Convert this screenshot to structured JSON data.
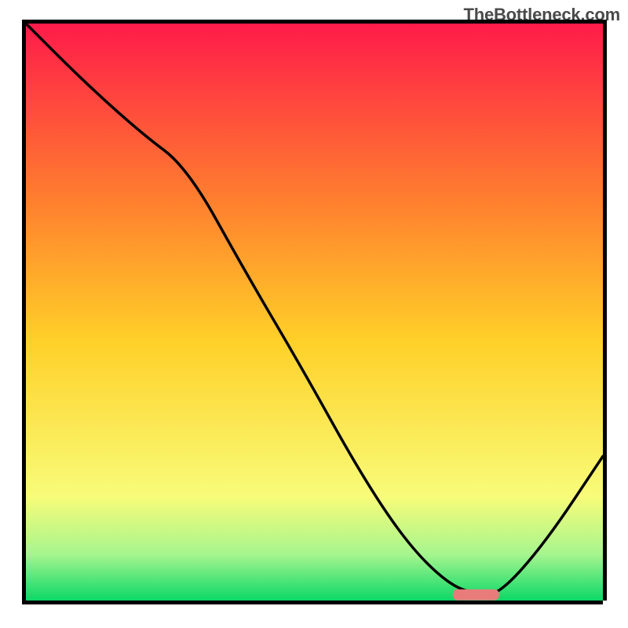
{
  "watermark": "TheBottleneck.com",
  "chart_data": {
    "type": "line",
    "title": "",
    "xlabel": "",
    "ylabel": "",
    "xlim": [
      0,
      100
    ],
    "ylim": [
      0,
      100
    ],
    "grid": false,
    "legend": "none",
    "series": [
      {
        "name": "bottleneck-curve",
        "x": [
          0,
          10,
          20,
          28,
          38,
          48,
          58,
          66,
          73,
          78,
          82,
          90,
          100
        ],
        "y": [
          100,
          90,
          81,
          75,
          57,
          40,
          22,
          10,
          3,
          1,
          1,
          10,
          25
        ]
      }
    ],
    "marker": {
      "name": "optimal-segment",
      "x_start": 74,
      "x_end": 82,
      "y": 1,
      "color": "#e97b7b"
    },
    "gradient_colors": {
      "top": "#ff1b4a",
      "upper_mid": "#ff7d2f",
      "mid": "#ffd028",
      "lower_mid": "#f8fc79",
      "lower": "#a6f58e",
      "bottom": "#0bd867"
    }
  }
}
